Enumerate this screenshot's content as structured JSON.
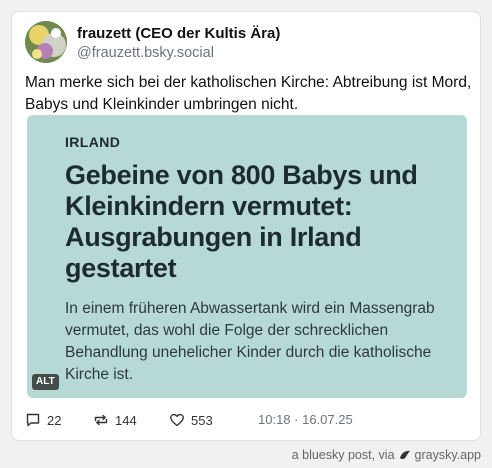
{
  "post": {
    "author": {
      "display_name": "frauzett (CEO der Kultis Ära)",
      "handle": "@frauzett.bsky.social"
    },
    "text": "Man merke sich bei der katholischen Kirche: Abtreibung ist Mord, Babys und Kleinkinder umbringen nicht.",
    "embed": {
      "kicker": "IRLAND",
      "headline": "Gebeine von 800 Babys und Kleinkindern vermutet: Ausgrabungen in Irland gestartet",
      "lede": "In einem früheren Abwassertank wird ein Massengrab vermutet, das wohl die Folge der schrecklichen Behandlung unehelicher Kinder durch die katholische Kirche ist.",
      "alt_badge": "ALT",
      "background_color": "#b6d9d5"
    },
    "stats": {
      "replies": "22",
      "reposts": "144",
      "likes": "553"
    },
    "timestamp": "10:18 · 16.07.25"
  },
  "footer": {
    "prefix": "a bluesky post, via",
    "brand": "graysky.app"
  }
}
